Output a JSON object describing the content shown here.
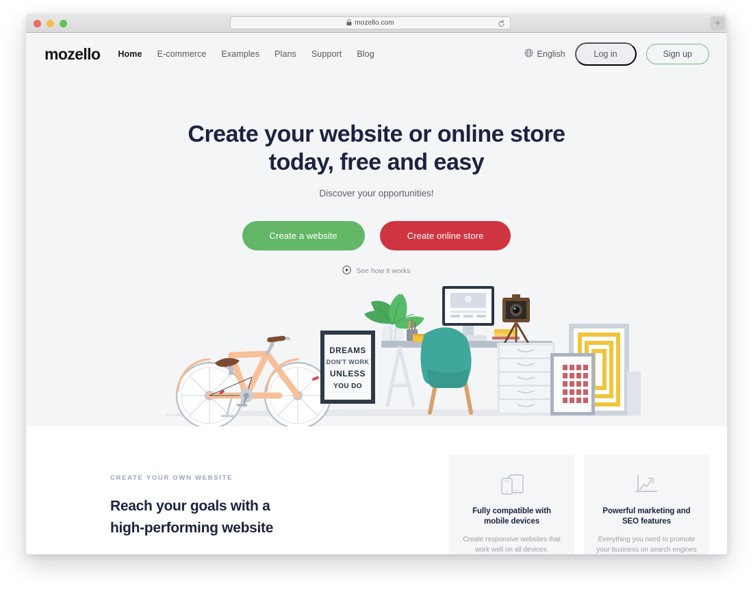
{
  "browser": {
    "url": "mozello.com",
    "lock_icon": "lock-icon",
    "reload_icon": "reload-icon",
    "new_tab_label": "+",
    "traffic_lights": [
      "close",
      "minimize",
      "maximize"
    ]
  },
  "header": {
    "logo": "mozello",
    "nav": [
      {
        "label": "Home",
        "active": true
      },
      {
        "label": "E-commerce",
        "active": false
      },
      {
        "label": "Examples",
        "active": false
      },
      {
        "label": "Plans",
        "active": false
      },
      {
        "label": "Support",
        "active": false
      },
      {
        "label": "Blog",
        "active": false
      }
    ],
    "language": {
      "icon": "globe-icon",
      "label": "English"
    },
    "login_label": "Log in",
    "signup_label": "Sign up"
  },
  "hero": {
    "title_line1": "Create your website or online store",
    "title_line2": "today, free and easy",
    "subtitle": "Discover your opportunities!",
    "cta_primary": "Create a website",
    "cta_secondary": "Create online store",
    "video_link": "See how it works",
    "video_icon": "play-circle-icon",
    "poster_text": {
      "line1": "DREAMS",
      "line2": "DON'T WORK",
      "line3": "UNLESS",
      "line4": "YOU DO"
    }
  },
  "features": {
    "eyebrow": "CREATE YOUR OWN WEBSITE",
    "title_line1": "Reach your goals with a",
    "title_line2": "high-performing website",
    "cards": [
      {
        "icon": "mobile-devices-icon",
        "title_line1": "Fully compatible with",
        "title_line2": "mobile devices",
        "text": "Create responsive websites that work well on all devices."
      },
      {
        "icon": "growth-chart-icon",
        "title_line1": "Powerful marketing and",
        "title_line2": "SEO features",
        "text": "Everything you need to promote your business on search engines and social networks."
      }
    ]
  },
  "colors": {
    "brand_dark": "#1b2340",
    "cta_green": "#64b767",
    "cta_red": "#cf3540",
    "hero_bg": "#f4f5f7",
    "card_bg": "#f5f6f7",
    "eyebrow": "#98a6c4"
  }
}
